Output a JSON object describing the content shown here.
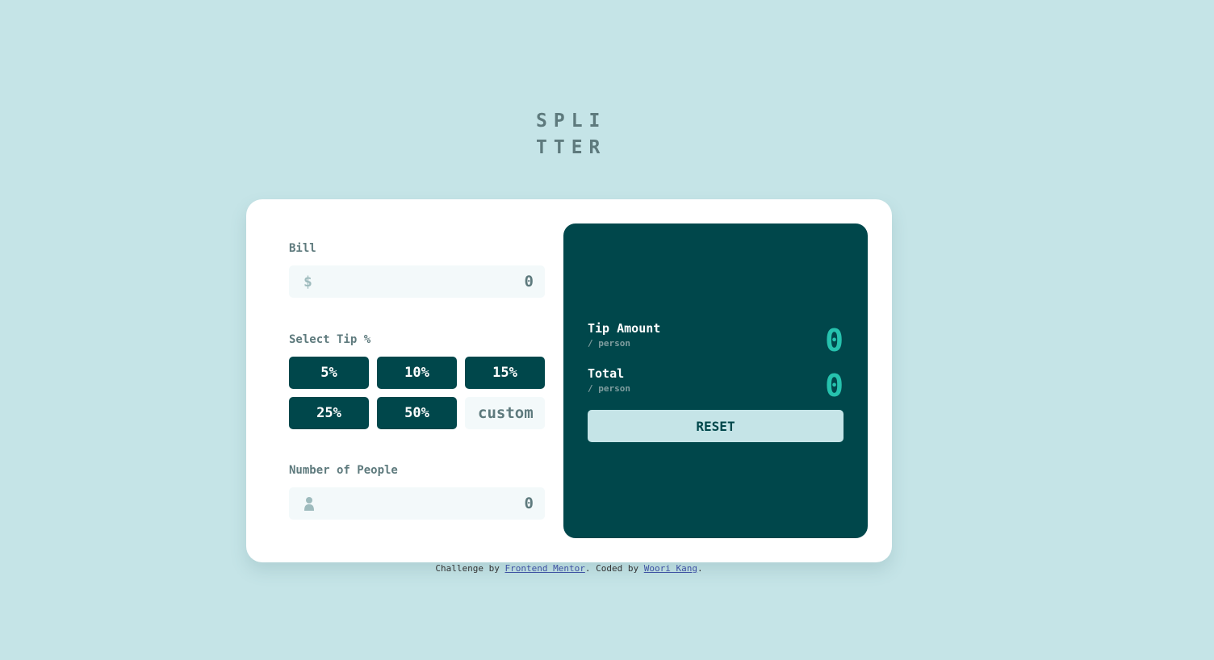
{
  "logo": {
    "line1": "SPLI",
    "line2": "TTER"
  },
  "bill": {
    "label": "Bill",
    "icon": "dollar-icon",
    "icon_glyph": "$",
    "placeholder": "0"
  },
  "tip": {
    "label": "Select Tip %",
    "options": [
      "5%",
      "10%",
      "15%",
      "25%",
      "50%"
    ],
    "custom_placeholder": "custom"
  },
  "people": {
    "label": "Number of People",
    "icon": "person-icon",
    "placeholder": "0"
  },
  "results": {
    "tip_amount": {
      "title": "Tip Amount",
      "sub": "/ person",
      "value": "0"
    },
    "total": {
      "title": "Total",
      "sub": "/ person",
      "value": "0"
    },
    "reset_label": "RESET"
  },
  "attribution": {
    "prefix": "Challenge by ",
    "link1": "Frontend Mentor",
    "middle": ". Coded by ",
    "link2": "Woori Kang",
    "suffix": "."
  },
  "colors": {
    "background": "#c5e4e7",
    "dark_cyan": "#00474b",
    "strong_cyan": "#26c2ae",
    "grayish_cyan": "#5e7a7d",
    "input_bg": "#f3f9fa"
  }
}
